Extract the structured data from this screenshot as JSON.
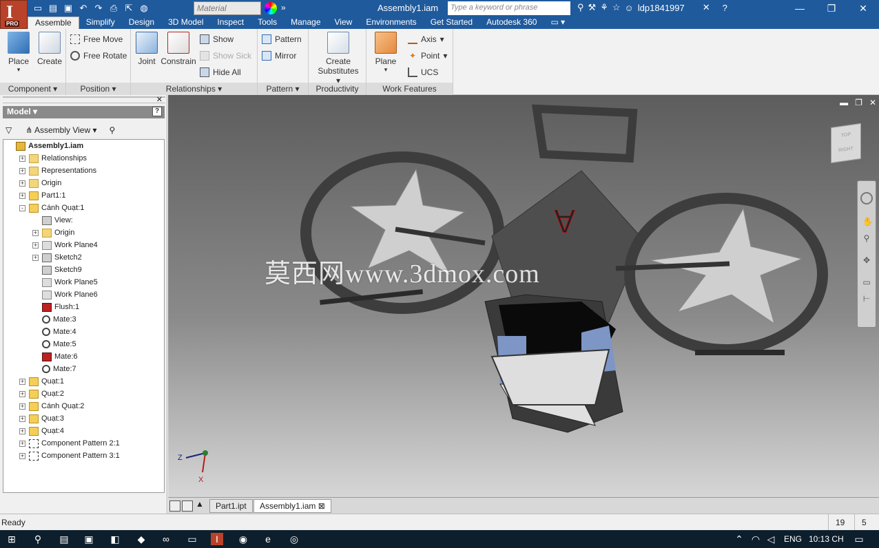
{
  "app": {
    "title": "Assembly1.iam",
    "logo_letter": "I",
    "logo_badge": "PRO"
  },
  "qat": {
    "material_placeholder": "Material",
    "search_placeholder": "Type a keyword or phrase",
    "user": "ldp1841997"
  },
  "tabs": [
    "Assemble",
    "Simplify",
    "Design",
    "3D Model",
    "Inspect",
    "Tools",
    "Manage",
    "View",
    "Environments",
    "Get Started",
    "Autodesk 360"
  ],
  "ribbon": {
    "component": {
      "title": "Component",
      "place": "Place",
      "create": "Create"
    },
    "position": {
      "title": "Position",
      "free_move": "Free Move",
      "free_rotate": "Free Rotate"
    },
    "relationships": {
      "title": "Relationships",
      "joint": "Joint",
      "constrain": "Constrain",
      "show": "Show",
      "show_sick": "Show Sick",
      "hide_all": "Hide All"
    },
    "pattern": {
      "title": "Pattern",
      "pattern": "Pattern",
      "mirror": "Mirror"
    },
    "productivity": {
      "title": "Productivity",
      "create_substitutes_1": "Create",
      "create_substitutes_2": "Substitutes"
    },
    "work_features": {
      "title": "Work Features",
      "plane": "Plane",
      "axis": "Axis",
      "point": "Point",
      "ucs": "UCS"
    }
  },
  "browser": {
    "header": "Model",
    "view": "Assembly View",
    "tree": [
      {
        "label": "Assembly1.iam",
        "icon": "asm",
        "pm": "",
        "bold": true
      },
      {
        "label": "Relationships",
        "icon": "folder",
        "pm": "+"
      },
      {
        "label": "Representations",
        "icon": "folder",
        "pm": "+"
      },
      {
        "label": "Origin",
        "icon": "folder",
        "pm": "+"
      },
      {
        "label": "Part1:1",
        "icon": "part",
        "pm": "+"
      },
      {
        "label": "Cánh Quạt:1",
        "icon": "part",
        "pm": "-"
      },
      {
        "label": "View:",
        "icon": "sketch",
        "pm": ""
      },
      {
        "label": "Origin",
        "icon": "folder",
        "pm": "+"
      },
      {
        "label": "Work Plane4",
        "icon": "plane",
        "pm": "+"
      },
      {
        "label": "Sketch2",
        "icon": "sketch",
        "pm": "+"
      },
      {
        "label": "Sketch9",
        "icon": "sketch",
        "pm": ""
      },
      {
        "label": "Work Plane5",
        "icon": "plane",
        "pm": ""
      },
      {
        "label": "Work Plane6",
        "icon": "plane",
        "pm": ""
      },
      {
        "label": "Flush:1",
        "icon": "flush",
        "pm": ""
      },
      {
        "label": "Mate:3",
        "icon": "mate",
        "pm": ""
      },
      {
        "label": "Mate:4",
        "icon": "mate",
        "pm": ""
      },
      {
        "label": "Mate:5",
        "icon": "mate",
        "pm": ""
      },
      {
        "label": "Mate:6",
        "icon": "flush",
        "pm": ""
      },
      {
        "label": "Mate:7",
        "icon": "mate",
        "pm": ""
      },
      {
        "label": "Quạt:1",
        "icon": "part",
        "pm": "+"
      },
      {
        "label": "Quạt:2",
        "icon": "part",
        "pm": "+"
      },
      {
        "label": "Cánh Quạt:2",
        "icon": "part",
        "pm": "+"
      },
      {
        "label": "Quạt:3",
        "icon": "part",
        "pm": "+"
      },
      {
        "label": "Quạt:4",
        "icon": "part",
        "pm": "+"
      },
      {
        "label": "Component Pattern 2:1",
        "icon": "pattern",
        "pm": "+"
      },
      {
        "label": "Component Pattern 3:1",
        "icon": "pattern",
        "pm": "+"
      }
    ]
  },
  "viewport": {
    "watermark": "莫西网www.3dmox.com",
    "viewcube_top": "TOP",
    "viewcube_right": "RIGHT",
    "axis_z": "Z",
    "axis_x": "X"
  },
  "doc_tabs": {
    "tab1": "Part1.ipt",
    "tab2": "Assembly1.iam"
  },
  "status": {
    "text": "Ready",
    "num1": "19",
    "num2": "5"
  },
  "taskbar": {
    "lang": "ENG",
    "time": "10:13 CH"
  }
}
